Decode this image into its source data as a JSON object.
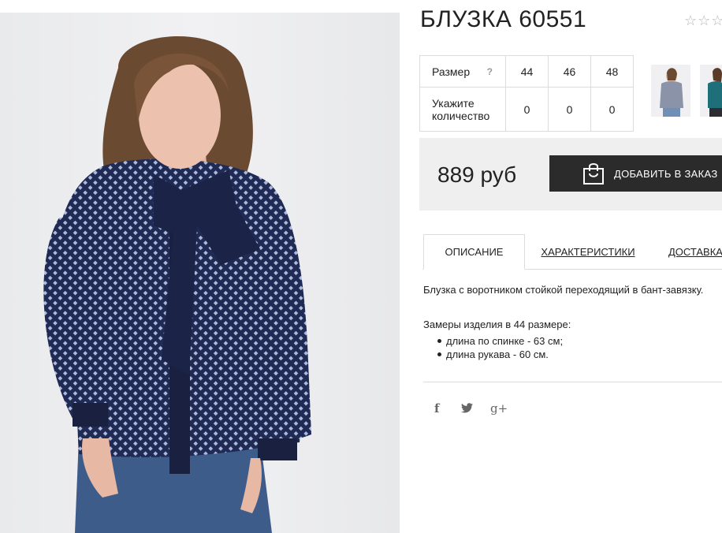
{
  "product": {
    "title": "БЛУЗКА 60551",
    "rating": {
      "filled": 0,
      "total": 5
    }
  },
  "sizes": {
    "size_label": "Размер",
    "help_glyph": "?",
    "qty_label": "Укажите количество",
    "columns": [
      "44",
      "46",
      "48"
    ],
    "quantities": [
      "0",
      "0",
      "0"
    ]
  },
  "thumbnails": [
    {
      "name": "blouse-grey-thumbnail",
      "color": "#8a93a8"
    },
    {
      "name": "blouse-teal-thumbnail",
      "color": "#1f6f7a"
    }
  ],
  "price": {
    "value": "889 руб",
    "button_label": "ДОБАВИТЬ В ЗАКАЗ",
    "button_icon": "shopping-bag-icon"
  },
  "tabs": [
    {
      "label": "ОПИСАНИЕ",
      "active": true
    },
    {
      "label": "ХАРАКТЕРИСТИКИ",
      "active": false
    },
    {
      "label": "ДОСТАВКА",
      "active": false
    }
  ],
  "description": {
    "text": "Блузка с воротником стойкой переходящий в бант-завязку.",
    "measures_title": "Замеры изделия в 44 размере:",
    "measures": [
      "длина по спинке - 63 см;",
      "длина рукава - 60 см."
    ]
  },
  "social": {
    "facebook": "f",
    "twitter": "🐦",
    "google_plus": "g+"
  },
  "colors": {
    "accent_dark": "#2b2b2b",
    "price_bg": "#efefef",
    "blouse_navy": "#1c2446"
  }
}
